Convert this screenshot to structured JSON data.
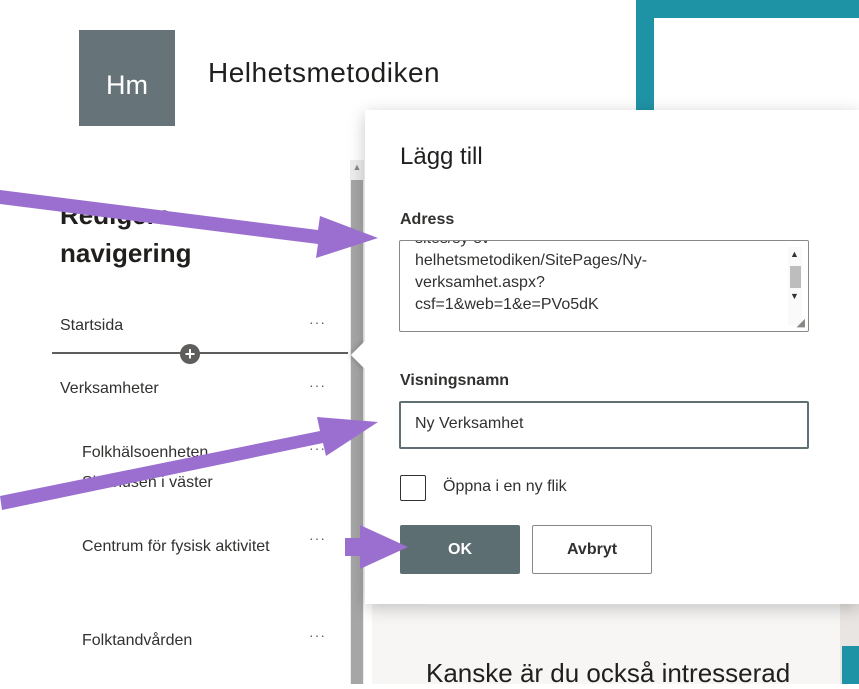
{
  "site": {
    "logo_initials": "Hm",
    "title": "Helhetsmetodiken"
  },
  "nav_editor": {
    "heading": "Redigera navigering",
    "items": [
      {
        "label": "Startsida",
        "menu": "···"
      },
      {
        "label": "Verksamheter",
        "menu": "···"
      }
    ],
    "sub_items": [
      {
        "label": "Folkhälsoenheten Sjukhusen i väster",
        "menu": "···"
      },
      {
        "label": "Centrum för fysisk aktivitet",
        "menu": "···"
      },
      {
        "label": "Folktandvården",
        "menu": "···"
      }
    ],
    "insert_symbol": "+"
  },
  "dialog": {
    "title": "Lägg till",
    "address_label": "Adress",
    "address_value": "sites/sy-sv-\nhelhetsmetodiken/SitePages/Ny-\nverksamhet.aspx?\ncsf=1&web=1&e=PVo5dK",
    "display_name_label": "Visningsnamn",
    "display_name_value": "Ny Verksamhet",
    "new_tab_label": "Öppna i en ny flik",
    "new_tab_checked": false,
    "ok_label": "OK",
    "cancel_label": "Avbryt"
  },
  "page": {
    "bottom_heading": "Kanske är du också intresserad"
  },
  "colors": {
    "accent_teal": "#1f93a6",
    "primary_button": "#5d6e72",
    "annotation_arrow": "#9b6fd0"
  }
}
